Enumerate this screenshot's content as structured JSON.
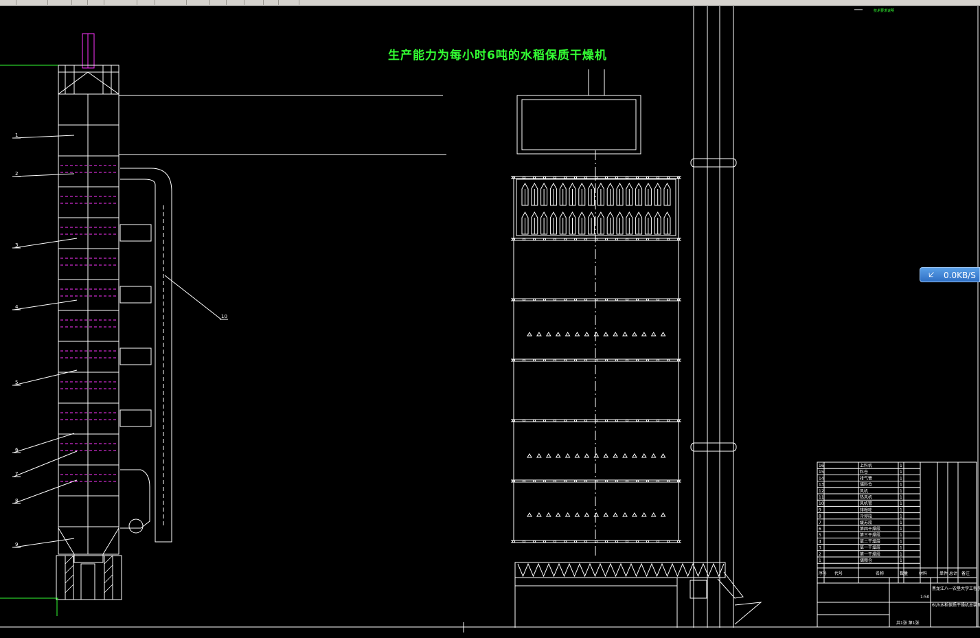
{
  "drawing": {
    "title": "生产能力为每小时6吨的水稻保质干燥机",
    "part_callouts": [
      "1",
      "2",
      "3",
      "4",
      "5",
      "6",
      "7",
      "8",
      "9",
      "10"
    ]
  },
  "network_badge": {
    "icon": "down-arrow-icon",
    "speed": "0.0KB/S"
  },
  "title_block": {
    "header_cols": [
      "序号",
      "代号",
      "名称",
      "数量",
      "材料",
      "单件",
      "总计",
      "备注"
    ],
    "rows": [
      {
        "no": "16",
        "name": "上料机",
        "qty": "1"
      },
      {
        "no": "15",
        "name": "料仓",
        "qty": "1"
      },
      {
        "no": "14",
        "name": "排气管",
        "qty": "1"
      },
      {
        "no": "13",
        "name": "储料仓",
        "qty": "1"
      },
      {
        "no": "12",
        "name": "风机",
        "qty": "1"
      },
      {
        "no": "11",
        "name": "热风机",
        "qty": "1"
      },
      {
        "no": "10",
        "name": "风机管",
        "qty": "1"
      },
      {
        "no": "9",
        "name": "排粮轮",
        "qty": "1"
      },
      {
        "no": "8",
        "name": "冷却段",
        "qty": "1"
      },
      {
        "no": "7",
        "name": "缓苏段",
        "qty": "1"
      },
      {
        "no": "6",
        "name": "第四干燥段",
        "qty": "1"
      },
      {
        "no": "5",
        "name": "第三干燥段",
        "qty": "1"
      },
      {
        "no": "4",
        "name": "第二干燥段",
        "qty": "1"
      },
      {
        "no": "3",
        "name": "第一干燥段",
        "qty": "1"
      },
      {
        "no": "2",
        "name": "第一干燥段",
        "qty": "1"
      },
      {
        "no": "1",
        "name": "储粮仓",
        "qty": "1"
      }
    ],
    "school": "黑龙江八一农垦大学工程学院",
    "doc_name": "6t/h水稻保质干燥机总装图",
    "scale": "1:50",
    "sheet": "共1张 第1张"
  },
  "colors": {
    "outline": "#ffffff",
    "hidden_lines": "#ff33ff",
    "title": "#33ff33",
    "badge": "#3b82d6"
  }
}
